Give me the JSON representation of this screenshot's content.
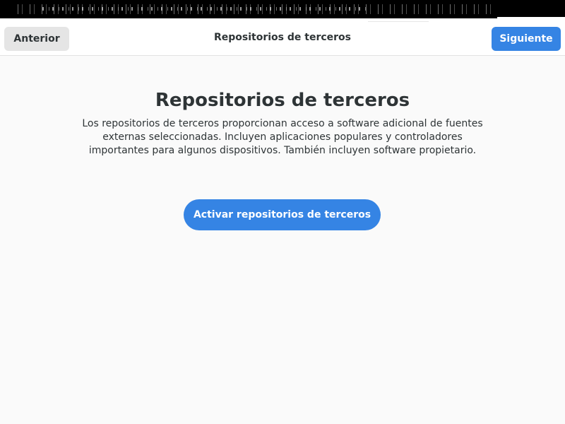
{
  "header": {
    "back_label": "Anterior",
    "title": "Repositorios de terceros",
    "next_label": "Siguiente"
  },
  "main": {
    "title": "Repositorios de terceros",
    "description": "Los repositorios de terceros proporcionan acceso a software adicional de fuentes externas seleccionadas. Incluyen aplicaciones populares y controladores importantes para algunos dispositivos. También incluyen software propietario.",
    "enable_button_label": "Activar repositorios de terceros"
  },
  "colors": {
    "accent": "#3584e4",
    "background": "#fafafa",
    "header_background": "#ffffff",
    "text": "#2e3436"
  }
}
